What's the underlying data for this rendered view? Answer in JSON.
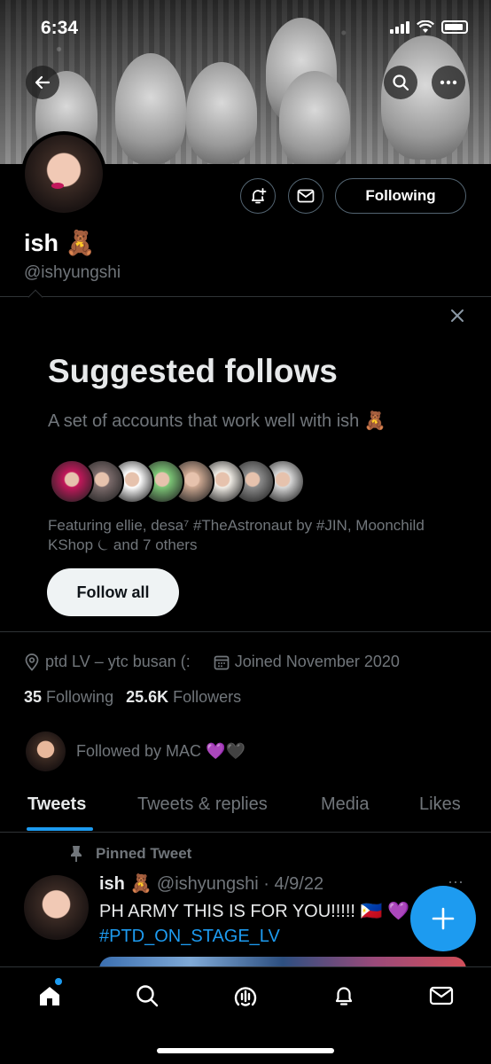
{
  "status_bar": {
    "time": "6:34"
  },
  "profile": {
    "name": "ish 🧸",
    "handle": "@ishyungshi",
    "following_button": "Following",
    "location": "ptd LV – ytc busan (:",
    "joined": "Joined November 2020",
    "following_count": "35",
    "following_label": "Following",
    "followers_count": "25.6K",
    "followers_label": "Followers",
    "followed_by": "Followed by MAC 💜🖤"
  },
  "suggested": {
    "title": "Suggested follows",
    "subtitle": "A set of accounts that work well with ish 🧸",
    "featuring": "Featuring ellie, desa⁷ #TheAstronaut by #JIN, Moonchild KShop ⏾ and 7 others",
    "follow_all": "Follow all",
    "avatar_colors": [
      "#c2185b",
      "#7a6a6a",
      "#ffffff",
      "#7cc576",
      "#c9a58f",
      "#f1ede6",
      "#8a8a8a",
      "#d8d8d8"
    ]
  },
  "tabs": [
    "Tweets",
    "Tweets & replies",
    "Media",
    "Likes"
  ],
  "pinned_tweet": {
    "label": "Pinned Tweet",
    "author": "ish 🧸",
    "handle_date": "@ishyungshi · 4/9/22",
    "text": "PH ARMY THIS IS FOR YOU!!!!! 🇵🇭 💜",
    "hashtag": "#PTD_ON_STAGE_LV",
    "more": "···"
  },
  "icons": {
    "back": "back-arrow-icon",
    "search": "search-icon",
    "more": "more-horizontal-icon",
    "notify": "bell-plus-icon",
    "message": "envelope-icon",
    "close": "close-icon",
    "location": "location-pin-icon",
    "calendar": "calendar-icon",
    "pin": "pin-icon",
    "compose": "plus-icon",
    "nav_home": "home-icon",
    "nav_search": "search-icon",
    "nav_spaces": "spaces-icon",
    "nav_notifications": "bell-icon",
    "nav_messages": "envelope-icon"
  },
  "colors": {
    "accent": "#1d9bf0",
    "background": "#000000",
    "muted": "#71767b",
    "text": "#e7e9ea"
  }
}
